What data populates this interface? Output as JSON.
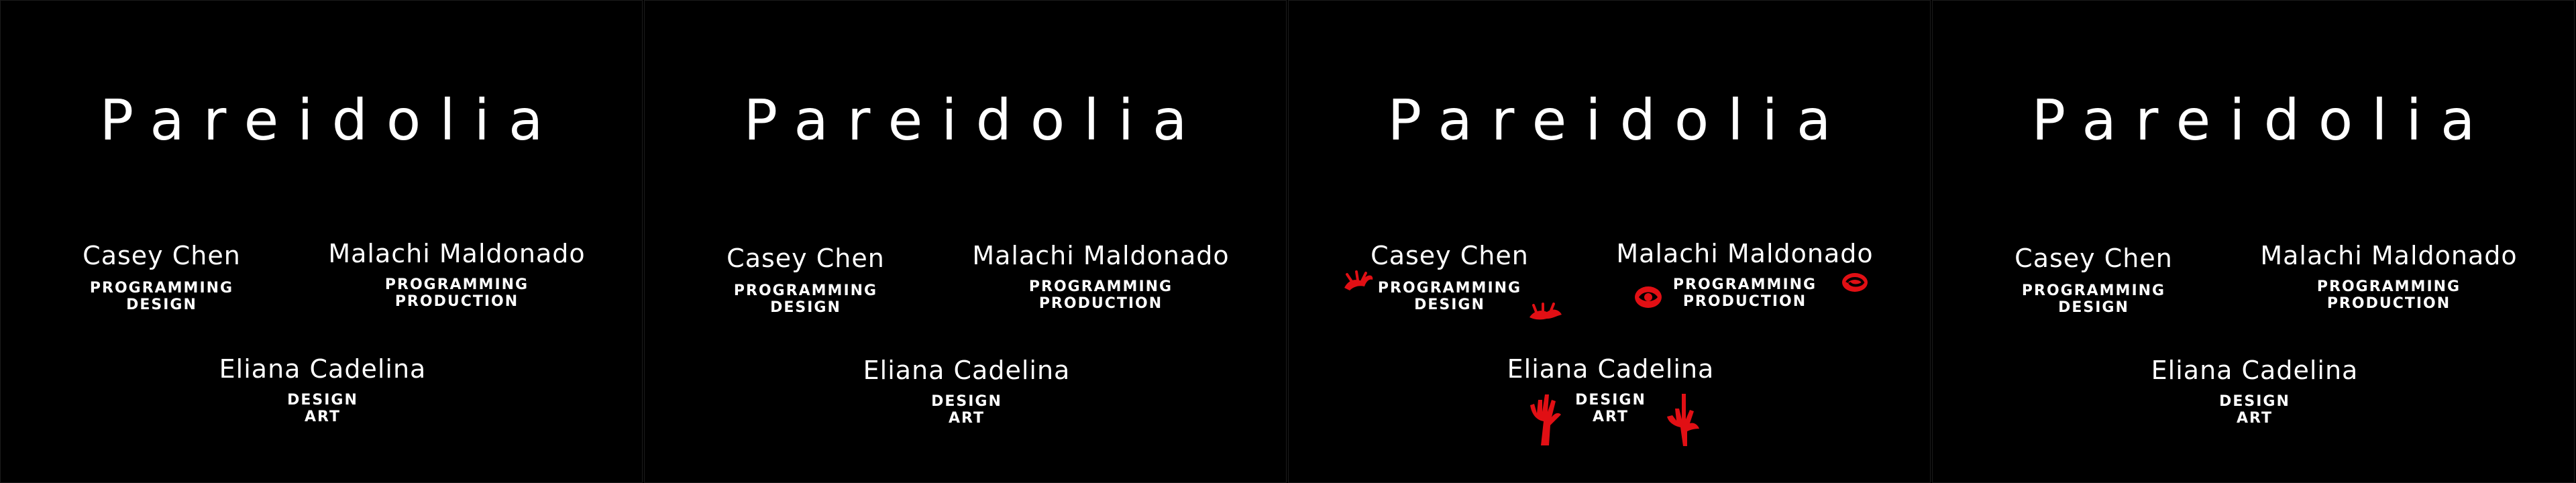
{
  "screens": [
    {
      "title": "Pareidolia"
    },
    {
      "title": "Pareidolia"
    },
    {
      "title": "Pareidolia"
    },
    {
      "title": "Pareidolia"
    }
  ],
  "credits": {
    "casey": {
      "name": "Casey Chen",
      "roles": [
        "PROGRAMMING",
        "DESIGN"
      ]
    },
    "malachi": {
      "name": "Malachi Maldonado",
      "roles": [
        "PROGRAMMING",
        "PRODUCTION"
      ]
    },
    "eliana": {
      "name": "Eliana Cadelina",
      "roles": [
        "DESIGN",
        "ART"
      ]
    }
  },
  "icons": [
    "red-crawler-icon",
    "red-creature-icon",
    "red-eye-icon",
    "red-swirl-icon",
    "red-hand-icon",
    "red-claw-icon"
  ],
  "colors": {
    "background": "#000000",
    "text": "#ffffff",
    "accent": "#e10f14"
  }
}
